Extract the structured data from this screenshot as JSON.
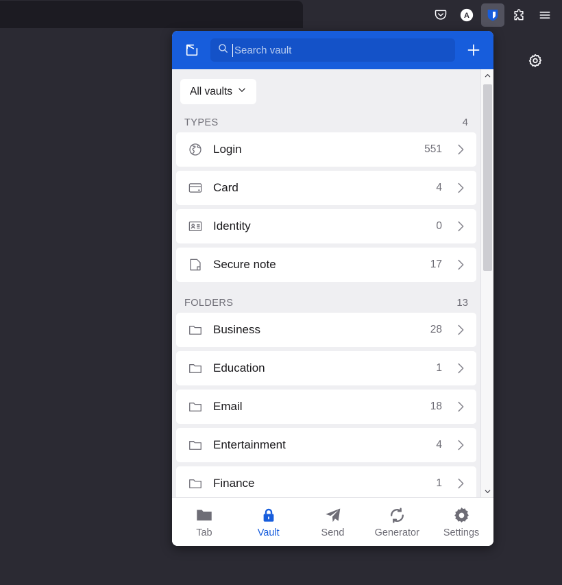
{
  "browser": {
    "toolbar_icons": [
      {
        "name": "pocket-icon",
        "label": "Pocket"
      },
      {
        "name": "account-avatar",
        "label": "A"
      },
      {
        "name": "bitwarden-extension-icon",
        "label": "Bitwarden"
      },
      {
        "name": "extensions-puzzle-icon",
        "label": "Extensions"
      },
      {
        "name": "application-menu-icon",
        "label": "Open application menu"
      }
    ],
    "page_gear_icon": "gear-icon"
  },
  "popup": {
    "header": {
      "popout_icon": "popout-icon",
      "search": {
        "placeholder": "Search vault",
        "value": "",
        "icon": "search-icon"
      },
      "add_icon": "plus-icon",
      "background_color": "#175ddc"
    },
    "vault_selector": {
      "label": "All vaults",
      "icon": "chevron-down-icon"
    },
    "sections": [
      {
        "id": "types",
        "title": "TYPES",
        "count": "4",
        "items": [
          {
            "icon": "globe-icon",
            "label": "Login",
            "count": "551"
          },
          {
            "icon": "credit-card-icon",
            "label": "Card",
            "count": "4"
          },
          {
            "icon": "id-card-icon",
            "label": "Identity",
            "count": "0"
          },
          {
            "icon": "note-icon",
            "label": "Secure note",
            "count": "17"
          }
        ]
      },
      {
        "id": "folders",
        "title": "FOLDERS",
        "count": "13",
        "items": [
          {
            "icon": "folder-icon",
            "label": "Business",
            "count": "28"
          },
          {
            "icon": "folder-icon",
            "label": "Education",
            "count": "1"
          },
          {
            "icon": "folder-icon",
            "label": "Email",
            "count": "18"
          },
          {
            "icon": "folder-icon",
            "label": "Entertainment",
            "count": "4"
          },
          {
            "icon": "folder-icon",
            "label": "Finance",
            "count": "1"
          }
        ]
      }
    ],
    "bottom_nav": [
      {
        "id": "tab",
        "label": "Tab",
        "icon": "folder-icon",
        "active": false
      },
      {
        "id": "vault",
        "label": "Vault",
        "icon": "lock-icon",
        "active": true
      },
      {
        "id": "send",
        "label": "Send",
        "icon": "send-icon",
        "active": false
      },
      {
        "id": "generator",
        "label": "Generator",
        "icon": "refresh-icon",
        "active": false
      },
      {
        "id": "settings",
        "label": "Settings",
        "icon": "gear-icon",
        "active": false
      }
    ],
    "colors": {
      "accent": "#175ddc",
      "body_background": "#efeff2",
      "card": "#ffffff",
      "muted_text": "#6e6d76"
    }
  }
}
